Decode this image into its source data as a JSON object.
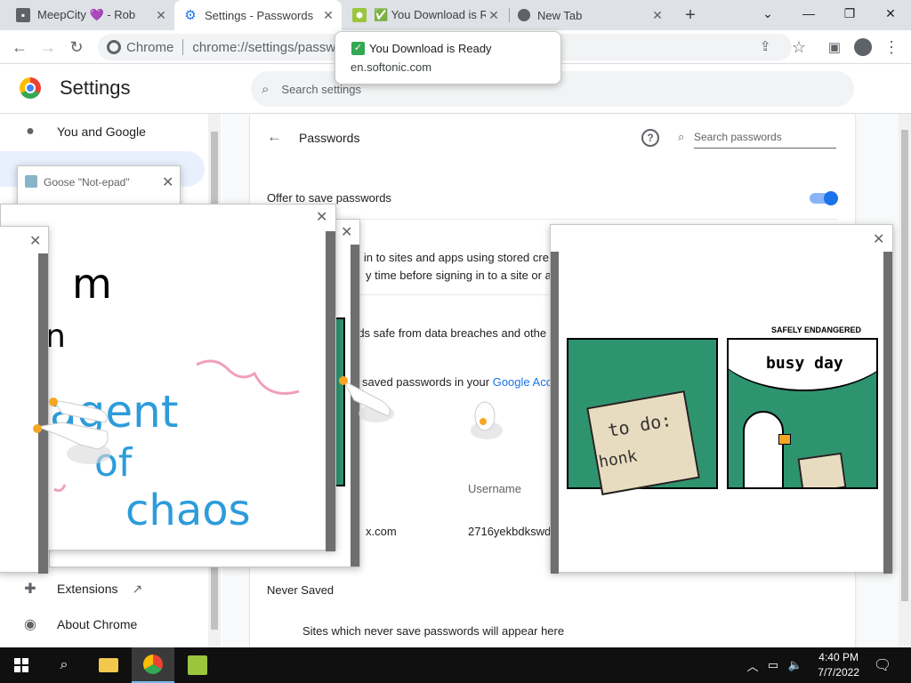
{
  "tabs": [
    {
      "title": "MeepCity 💜 - Rob",
      "icon": "puzzle-icon"
    },
    {
      "title": "Settings - Passwords",
      "icon": "gear-icon"
    },
    {
      "title": "✅ You Download is Re",
      "icon": "softonic-icon"
    },
    {
      "title": "New Tab",
      "icon": "chrome-icon"
    }
  ],
  "toolbar": {
    "site": "Chrome",
    "url": "chrome://settings/passwor"
  },
  "download_popup": {
    "title": "You Download is Ready",
    "domain": "en.softonic.com"
  },
  "header": {
    "title": "Settings",
    "search_placeholder": "Search settings"
  },
  "sidebar": {
    "items": [
      {
        "label": "You and Google",
        "icon": "person-icon"
      },
      {
        "label": "Extensions",
        "icon": "puzzle-icon"
      },
      {
        "label": "About Chrome",
        "icon": "chrome-icon"
      }
    ]
  },
  "passwords": {
    "heading": "Passwords",
    "search_placeholder": "Search passwords",
    "offer_label": "Offer to save passwords",
    "offer_enabled": true,
    "signin_text": "n in to sites and apps using stored cre",
    "signin_text2": "y time before signing in to a site or ap",
    "breach_text": "rds safe from data breaches and othe",
    "account_text": "saved passwords in your",
    "account_link": "Google Acc",
    "username_header": "Username",
    "row_site": "x.com",
    "row_username": "2716yekbdkswd",
    "never_saved_heading": "Never Saved",
    "never_saved_text": "Sites which never save passwords will appear here"
  },
  "notepad": {
    "title": "Goose \"Not-epad\""
  },
  "drawing": {
    "texts": [
      "m",
      "n",
      "agent",
      "of",
      "chaos"
    ]
  },
  "comic": {
    "tag": "SAFELY ENDANGERED",
    "panel1_title": "to do:",
    "panel1_text": "honk",
    "panel2_title": "busy day"
  },
  "taskbar": {
    "time": "4:40 PM",
    "date": "7/7/2022"
  },
  "colors": {
    "accent": "#1a73e8",
    "comic_green": "#2e9470"
  }
}
